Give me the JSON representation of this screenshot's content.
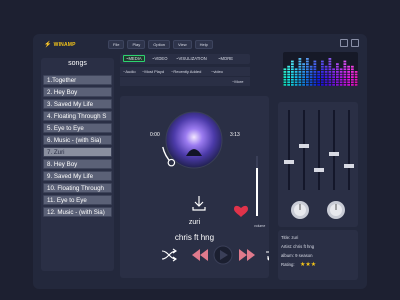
{
  "app": {
    "brand": "WINAMP"
  },
  "menu": [
    "File",
    "Play",
    "Option",
    "View",
    "Help"
  ],
  "library": {
    "tabs": [
      "~MEDIA",
      "~VIDEO",
      "~VISULIZATION",
      "~MORE"
    ],
    "subitems_row1": [
      "~Audio",
      "~Most Playd",
      "~Recently Added",
      "~video"
    ],
    "subitems_row2": [
      "~More"
    ]
  },
  "sidebar": {
    "title": "songs",
    "items": [
      "1.Together",
      "2. Hey Boy",
      "3. Saved My Life",
      "4. Floating Through S",
      "5. Eye to Eye",
      "6. Music - (with Sia)",
      "7. Zuri",
      "8. Hey Boy",
      "9. Saved My Life",
      "10. Floating Through",
      "11. Eye to Eye",
      "12. Music - (with Sia)"
    ]
  },
  "player": {
    "time_elapsed": "0:00",
    "time_total": "3:13",
    "song_title": "zuri",
    "artist": "chris ft hng",
    "volume_label": "volume",
    "progress": 0.12,
    "volume_level": 0.8,
    "liked": true
  },
  "visualizer": {
    "levels": [
      0.55,
      0.7,
      0.85,
      0.6,
      0.9,
      0.75,
      0.95,
      0.65,
      0.8,
      0.5,
      0.85,
      0.7,
      0.9,
      0.6,
      0.75,
      0.55,
      0.8,
      0.65,
      0.7,
      0.5
    ]
  },
  "equalizer": {
    "sliders": [
      0.35,
      0.55,
      0.25,
      0.45,
      0.3
    ]
  },
  "info": {
    "title_line": "Title: zuri",
    "artist_line": "Artist: chris ft hng",
    "album_line": "album: 9 season",
    "rating_label": "Rating:",
    "rating": 3,
    "rating_max": 5
  },
  "colors": {
    "accent_green": "#2dd36f",
    "like_red": "#e0334a",
    "star": "#f5c518",
    "bg": "#1d2031",
    "panel": "#2a2f45"
  }
}
